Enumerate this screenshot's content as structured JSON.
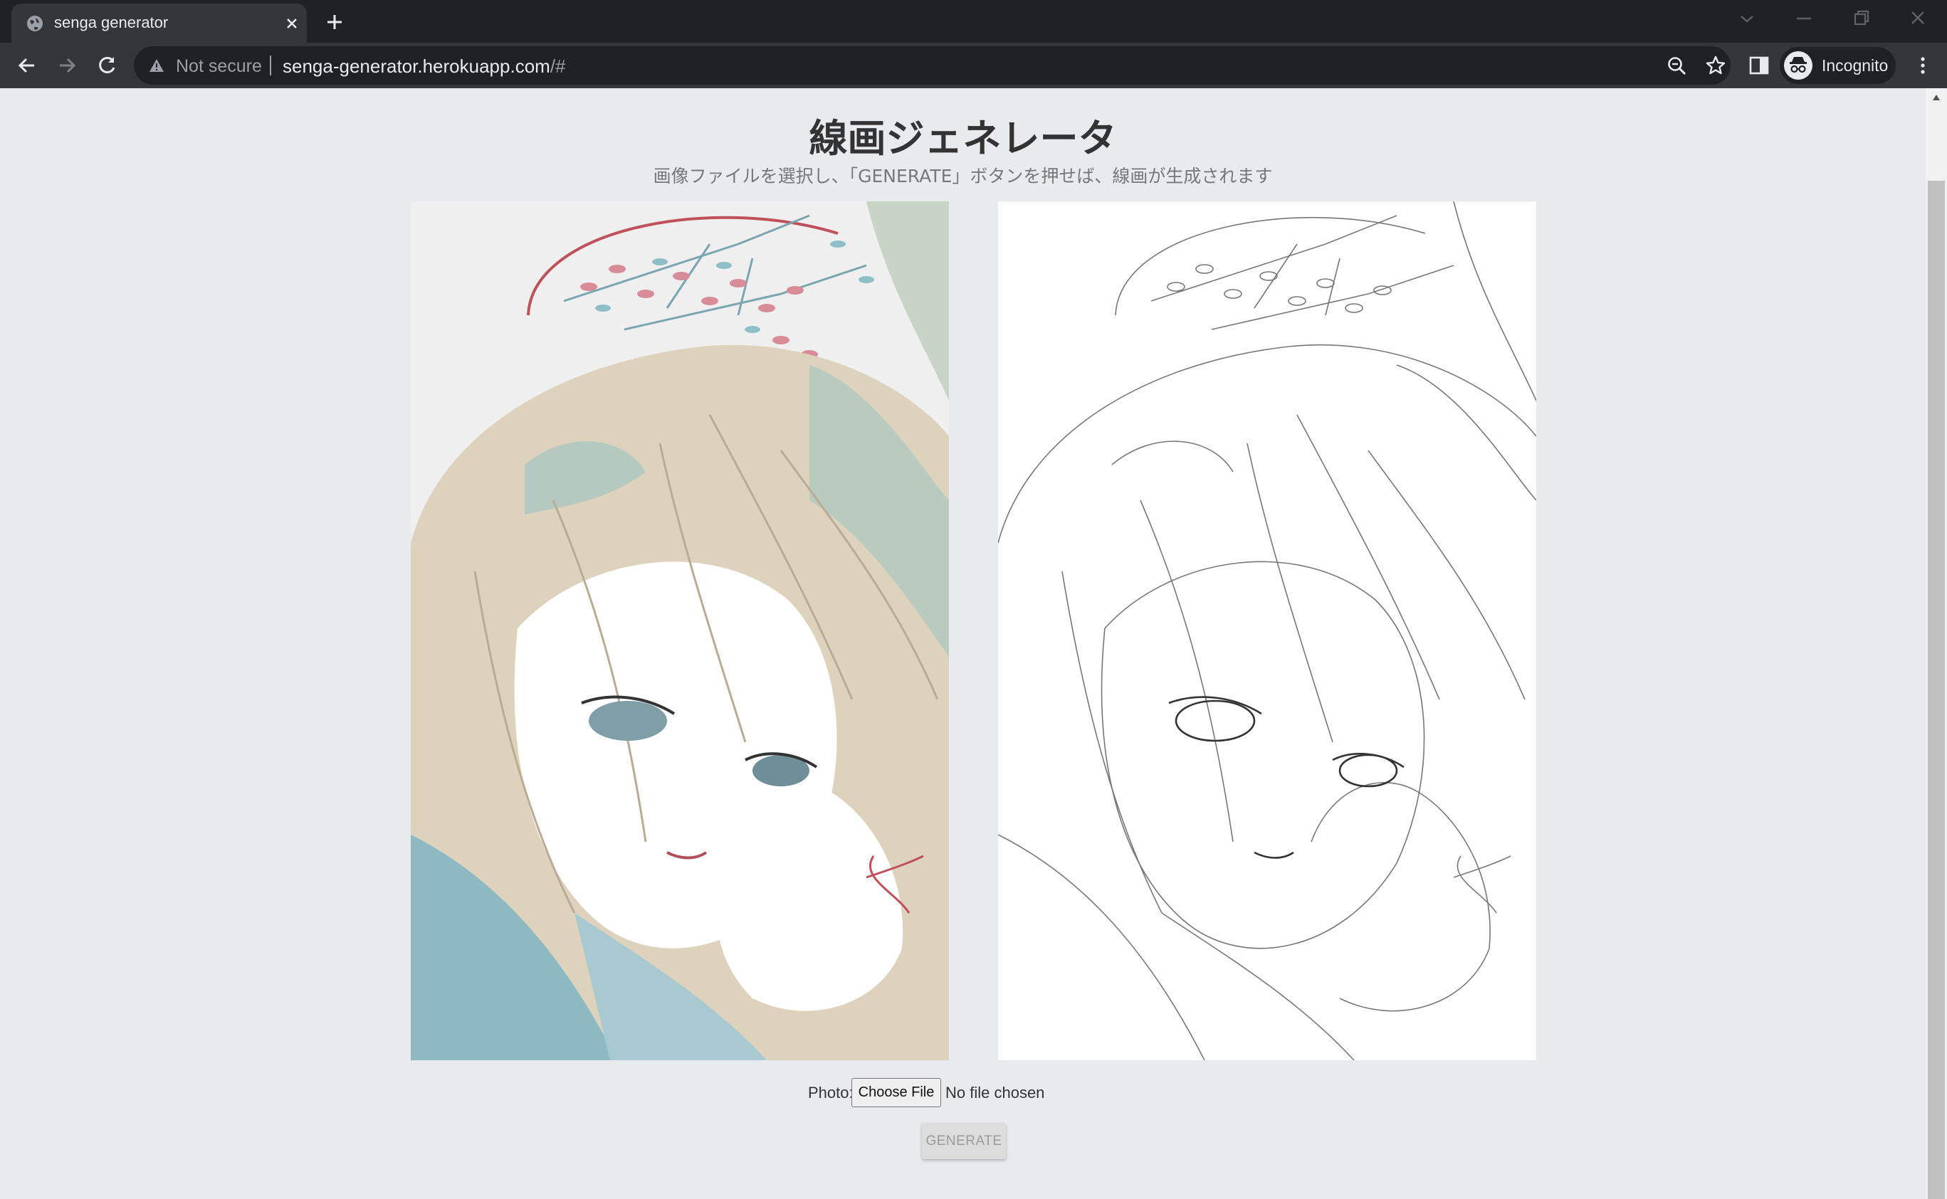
{
  "browser": {
    "tab_title": "senga generator",
    "security_label": "Not secure",
    "url_host": "senga-generator.herokuapp.com",
    "url_path": "/#",
    "profile_label": "Incognito"
  },
  "page": {
    "title": "線画ジェネレータ",
    "subtitle": "画像ファイルを選択し、「GENERATE」ボタンを押せば、線画が生成されます",
    "photo_label": "Photo:",
    "choose_file_label": "Choose File",
    "no_file_label": "No file chosen",
    "generate_label": "GENERATE"
  },
  "icons": {
    "favicon": "globe-icon",
    "tab_close": "close-icon",
    "new_tab": "plus-icon",
    "back": "arrow-left-icon",
    "forward": "arrow-right-icon",
    "reload": "reload-icon",
    "security": "warning-icon",
    "zoom": "zoom-out-icon",
    "bookmark": "star-icon",
    "side_panel": "side-panel-icon",
    "incognito": "incognito-icon",
    "menu": "kebab-menu-icon"
  },
  "colors": {
    "page_background": "#e8ebee",
    "hair": "#d9cfb8",
    "teal": "#a8c9cf",
    "accent_red": "#c0505a"
  }
}
